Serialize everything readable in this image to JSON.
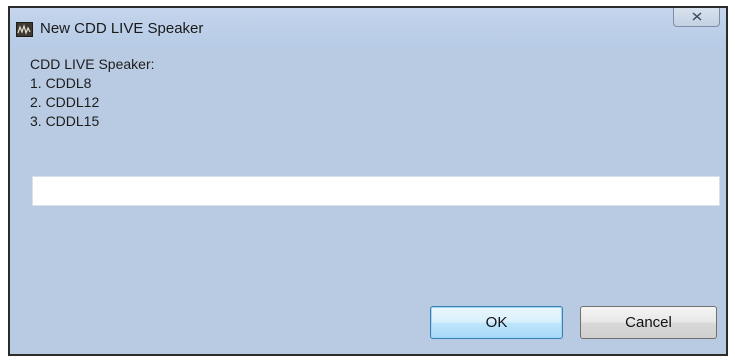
{
  "window": {
    "title": "New CDD LIVE Speaker",
    "icon": "app-icon",
    "close_icon": "close-icon"
  },
  "prompt": {
    "heading": "CDD LIVE Speaker:",
    "options": [
      "1. CDDL8",
      "2. CDDL12",
      "3. CDDL15"
    ]
  },
  "input": {
    "value": "",
    "placeholder": ""
  },
  "buttons": {
    "ok": "OK",
    "cancel": "Cancel"
  },
  "colors": {
    "dialog_background": "#b9cbe3",
    "default_button_border": "#3c7fb1"
  }
}
